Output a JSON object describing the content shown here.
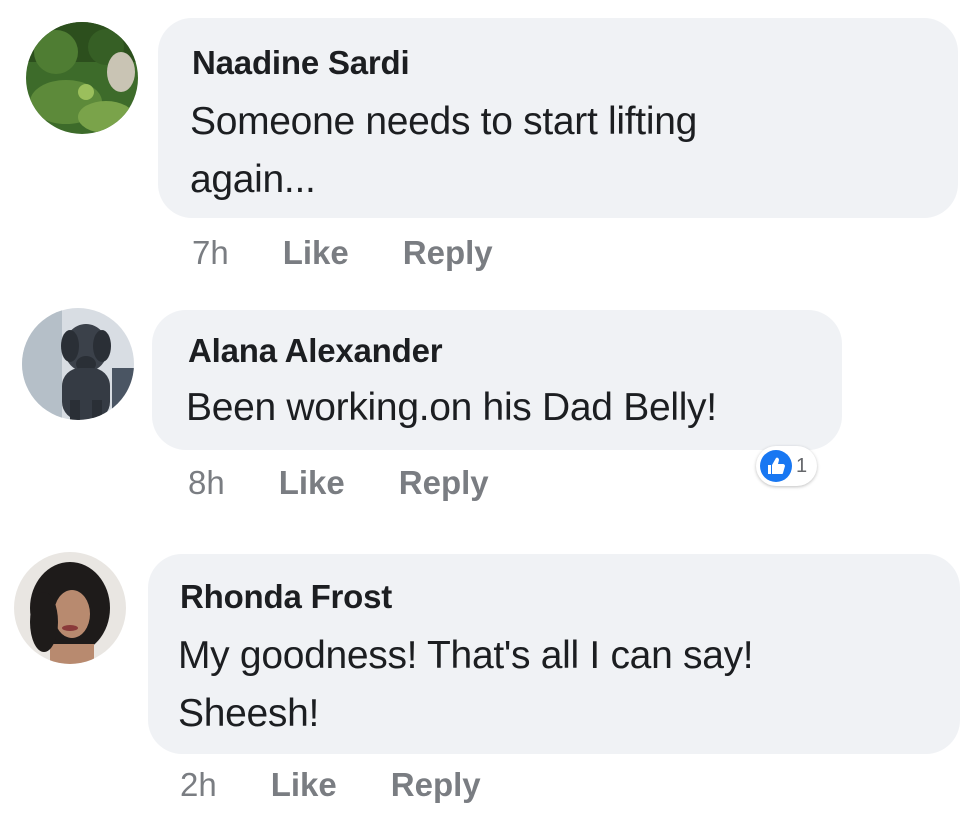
{
  "comments": [
    {
      "author": "Naadine Sardi",
      "text_lines": [
        "Someone needs to start lifting",
        "again..."
      ],
      "time": "7h",
      "like_label": "Like",
      "reply_label": "Reply",
      "avatar": "nature-photo-avatar"
    },
    {
      "author": "Alana Alexander",
      "text_lines": [
        "Been working.on his Dad Belly!"
      ],
      "time": "8h",
      "like_label": "Like",
      "reply_label": "Reply",
      "avatar": "dog-photo-avatar",
      "reaction": {
        "icon": "thumbs-up-icon",
        "count": "1",
        "color": "#1877f2"
      }
    },
    {
      "author": "Rhonda Frost",
      "text_lines": [
        "My goodness! That's all I can say!",
        "Sheesh!"
      ],
      "time": "2h",
      "like_label": "Like",
      "reply_label": "Reply",
      "avatar": "person-photo-avatar"
    }
  ],
  "colors": {
    "bubble": "#f0f2f5",
    "meta_text": "#7a7d82",
    "author_text": "#1c1e21",
    "like_blue": "#1877f2"
  }
}
